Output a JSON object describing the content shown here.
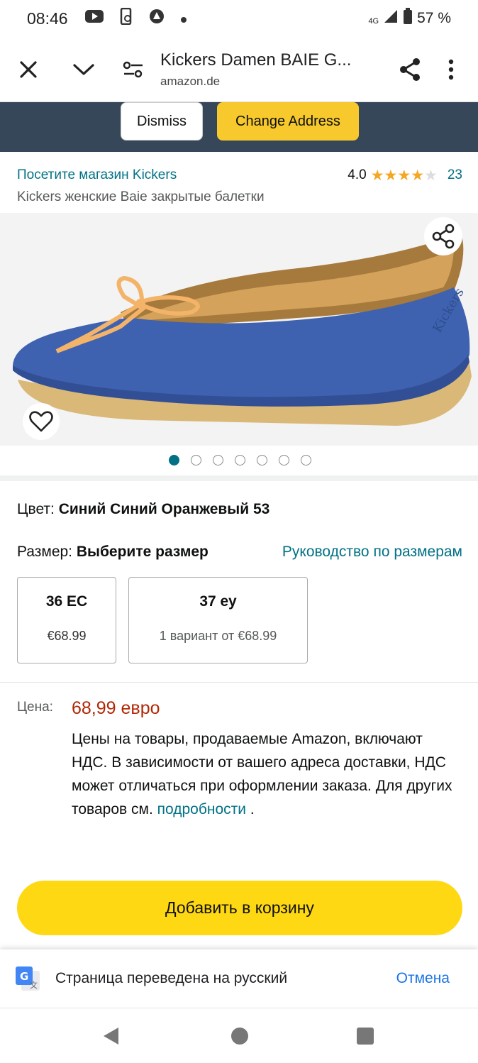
{
  "status_bar": {
    "time": "08:46",
    "network": "4G",
    "battery": "57 %",
    "icons": [
      "youtube-icon",
      "phone-sync-icon",
      "vpn-icon",
      "dot-icon",
      "signal-icon",
      "battery-icon"
    ]
  },
  "toolbar": {
    "title": "Kickers Damen BAIE G...",
    "domain": "amazon.de"
  },
  "banner": {
    "dismiss_label": "Dismiss",
    "change_address_label": "Change Address"
  },
  "product": {
    "store_link": "Посетите магазин Kickers",
    "rating": "4.0",
    "rating_stars": 4,
    "rating_count": "23",
    "subtitle": "Kickers женские Baie закрытые балетки",
    "image_dots": 7,
    "active_dot": 0
  },
  "variation": {
    "color_label": "Цвет:",
    "color_value": "Синий Синий Оранжевый 53",
    "size_label": "Размер:",
    "size_value": "Выберите размер",
    "size_guide": "Руководство по размерам",
    "sizes": [
      {
        "title": "36 EC",
        "price": "€68.99"
      },
      {
        "title": "37 еу",
        "price": "1 вариант от €68.99"
      }
    ]
  },
  "price": {
    "label": "Цена:",
    "value": "68,99 евро",
    "note": "Цены на товары, продаваемые Amazon, включают НДС. В зависимости от вашего адреса доставки, НДС может отличаться при оформлении заказа. Для других товаров см.",
    "details_link": "подробности",
    "note_end": "."
  },
  "cart": {
    "add_label": "Добавить в корзину"
  },
  "translate": {
    "message": "Страница переведена на русский",
    "cancel": "Отмена"
  },
  "colors": {
    "link": "#007185",
    "price": "#b12704",
    "cart_button": "#ffd814",
    "banner": "#37475a",
    "change_address": "#f7c92c"
  }
}
